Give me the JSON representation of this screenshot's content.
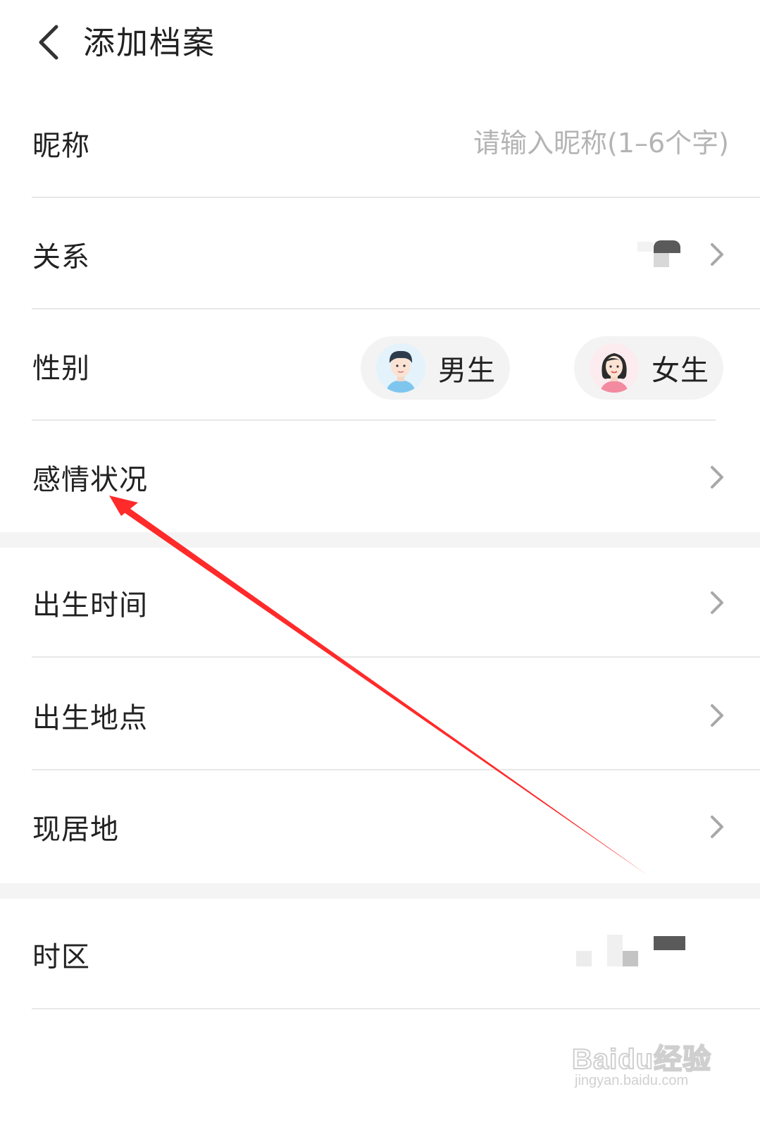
{
  "header": {
    "title": "添加档案"
  },
  "form": {
    "nickname": {
      "label": "昵称",
      "placeholder": "请输入昵称(1–6个字)"
    },
    "relation": {
      "label": "关系"
    },
    "gender": {
      "label": "性别",
      "options": [
        {
          "label": "男生",
          "icon": "male-avatar-icon"
        },
        {
          "label": "女生",
          "icon": "female-avatar-icon"
        }
      ]
    },
    "relationship_status": {
      "label": "感情状况"
    },
    "birth_time": {
      "label": "出生时间"
    },
    "birth_place": {
      "label": "出生地点"
    },
    "residence": {
      "label": "现居地"
    },
    "timezone": {
      "label": "时区"
    }
  },
  "watermark": {
    "logo": "Baidu经验",
    "url": "jingyan.baidu.com"
  },
  "colors": {
    "annotation_arrow": "#ff2a2a",
    "divider": "#e8e8e8",
    "section_gap": "#f4f4f4",
    "placeholder": "#b4b4b4",
    "chevron": "#a8a8a8"
  }
}
